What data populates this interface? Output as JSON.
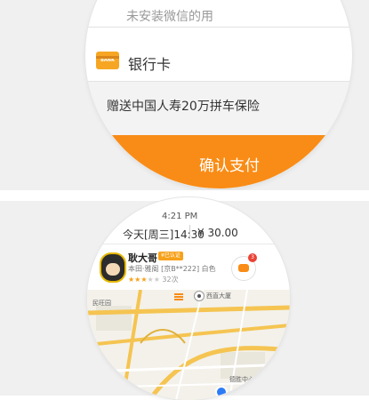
{
  "payment_screen": {
    "wechat_hint": "未安装微信的用",
    "bank_icon_text": "BANK",
    "bank_card_label": "银行卡",
    "insurance_text": "赠送中国人寿20万拼车保险",
    "confirm_label": "确认支付"
  },
  "trip_screen": {
    "status_time": "4:21 PM",
    "trip_time": "今天[周三]14:30",
    "trip_price": "¥ 30.00",
    "driver_name": "耿大哥",
    "vip_badge": "¥已认证",
    "car_info": "本田·雅阁 [京B**222] 白色",
    "rating_stars": "★★★",
    "rating_empty": "★★",
    "ride_count": "32次",
    "chat_unread": "3",
    "map_labels": {
      "left_area": "民旺园",
      "poi": "西直大厦",
      "bottom_right": "德胜中心"
    }
  },
  "colors": {
    "accent_orange": "#f98c16",
    "location_blue": "#2d7cf6"
  }
}
